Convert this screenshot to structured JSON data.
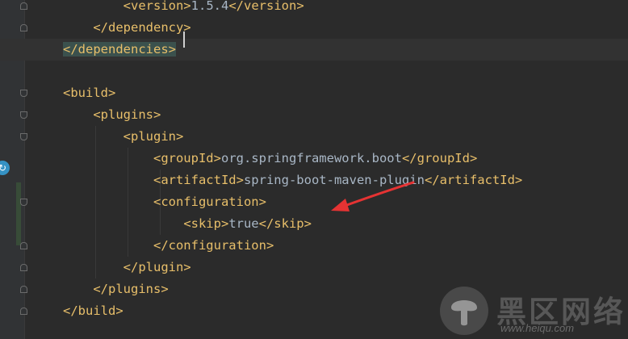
{
  "editor": {
    "lines": [
      {
        "text": "        <version>1.5.4</version>"
      },
      {
        "text": "    </dependency>"
      },
      {
        "text": "</dependencies>"
      },
      {
        "text": ""
      },
      {
        "text": "<build>"
      },
      {
        "text": "    <plugins>"
      },
      {
        "text": "        <plugin>"
      },
      {
        "text": "            <groupId>org.springframework.boot</groupId>"
      },
      {
        "text": "            <artifactId>spring-boot-maven-plugin</artifactId>"
      },
      {
        "text": "            <configuration>"
      },
      {
        "text": "                <skip>true</skip>"
      },
      {
        "text": "            </configuration>"
      },
      {
        "text": "        </plugin>"
      },
      {
        "text": "    </plugins>"
      },
      {
        "text": "</build>"
      }
    ],
    "gutter_icon": "run-reload-icon",
    "arrow_color": "#e53333"
  },
  "watermark": {
    "cn_text": "黑区网络",
    "url": "www.heiqu.com"
  },
  "colors": {
    "background": "#2b2b2b",
    "tag": "#e8bf6a",
    "text": "#a9b7c6",
    "gutter": "#313335"
  }
}
